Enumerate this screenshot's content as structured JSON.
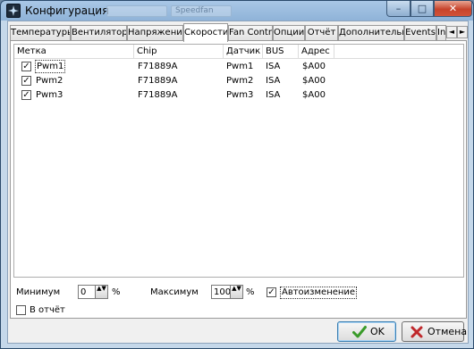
{
  "window": {
    "title": "Конфигурация",
    "ghost_tab_1": "",
    "ghost_tab_2": "Speedfan",
    "min_glyph": "–",
    "max_glyph": "□",
    "close_glyph": "✕"
  },
  "tabs": [
    {
      "label": "Температуры"
    },
    {
      "label": "Вентиляторы"
    },
    {
      "label": "Напряжения"
    },
    {
      "label": "Скорости"
    },
    {
      "label": "Fan Control"
    },
    {
      "label": "Опции"
    },
    {
      "label": "Отчёт"
    },
    {
      "label": "Дополнительно"
    },
    {
      "label": "Events"
    },
    {
      "label": "In"
    }
  ],
  "active_tab": "Скорости",
  "tab_scroll": {
    "left": "◄",
    "right": "►"
  },
  "table": {
    "columns": [
      "Метка",
      "Chip",
      "Датчик",
      "BUS",
      "Адрес"
    ],
    "rows": [
      {
        "checked": true,
        "label": "Pwm1",
        "chip": "F71889A",
        "sensor": "Pwm1",
        "bus": "ISA",
        "address": "$A00"
      },
      {
        "checked": true,
        "label": "Pwm2",
        "chip": "F71889A",
        "sensor": "Pwm2",
        "bus": "ISA",
        "address": "$A00"
      },
      {
        "checked": true,
        "label": "Pwm3",
        "chip": "F71889A",
        "sensor": "Pwm3",
        "bus": "ISA",
        "address": "$A00"
      }
    ],
    "check_glyph": "✓"
  },
  "settings": {
    "minimum_label": "Минимум",
    "minimum_value": "0",
    "minimum_unit": "%",
    "maximum_label": "Максимум",
    "maximum_value": "100",
    "maximum_unit": "%",
    "auto_change_label": "Автоизменение",
    "auto_change_checked": true,
    "in_report_label": "В отчёт",
    "in_report_checked": false,
    "spin_glyph": "▲▼"
  },
  "buttons": {
    "ok_label": "OK",
    "cancel_label": "Отмена"
  },
  "colors": {
    "ok_check": "#3a9b2a",
    "cancel_x": "#c0282b"
  }
}
